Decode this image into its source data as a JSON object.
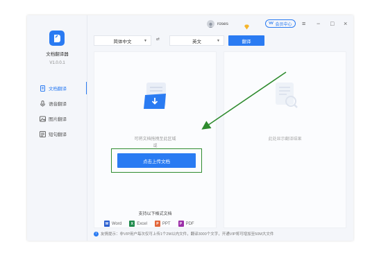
{
  "app": {
    "name": "文档翻译器",
    "version": "V1.0.0.1"
  },
  "sidebar": {
    "items": [
      {
        "label": "文档翻译",
        "icon": "document-icon",
        "active": true
      },
      {
        "label": "语音翻译",
        "icon": "microphone-icon",
        "active": false
      },
      {
        "label": "图片翻译",
        "icon": "image-icon",
        "active": false
      },
      {
        "label": "短句翻译",
        "icon": "text-icon",
        "active": false
      }
    ]
  },
  "titlebar": {
    "username": "roses",
    "vip_label": "会员中心",
    "controls": [
      "≡",
      "−",
      "□",
      "×"
    ]
  },
  "toolbar": {
    "source_lang": "简体中文",
    "target_lang": "英文",
    "swap_label": "⇄",
    "translate_label": "翻译"
  },
  "left_panel": {
    "drop_hint": "可将文档拖拽至此区域",
    "or_text": "或",
    "upload_label": "点击上传文档",
    "formats_title": "支持以下格式文档",
    "formats": [
      {
        "label": "Word",
        "letter": "W",
        "color": "#2b5fcf"
      },
      {
        "label": "Excel",
        "letter": "X",
        "color": "#1f8a4c"
      },
      {
        "label": "PPT",
        "letter": "P",
        "color": "#e2663a"
      },
      {
        "label": "PDF",
        "letter": "P",
        "color": "#9c2fa8"
      }
    ]
  },
  "right_panel": {
    "result_hint": "此处显示翻译结果"
  },
  "footer": {
    "tip_icon": "i",
    "tip": "友情提示：非VIP用户每次仅可上传1个2M以内文件，翻译3000个文字，开通VIP将可增加至50M大文件"
  },
  "colors": {
    "accent": "#2a7bf2",
    "annotation": "#2e8b2e"
  }
}
